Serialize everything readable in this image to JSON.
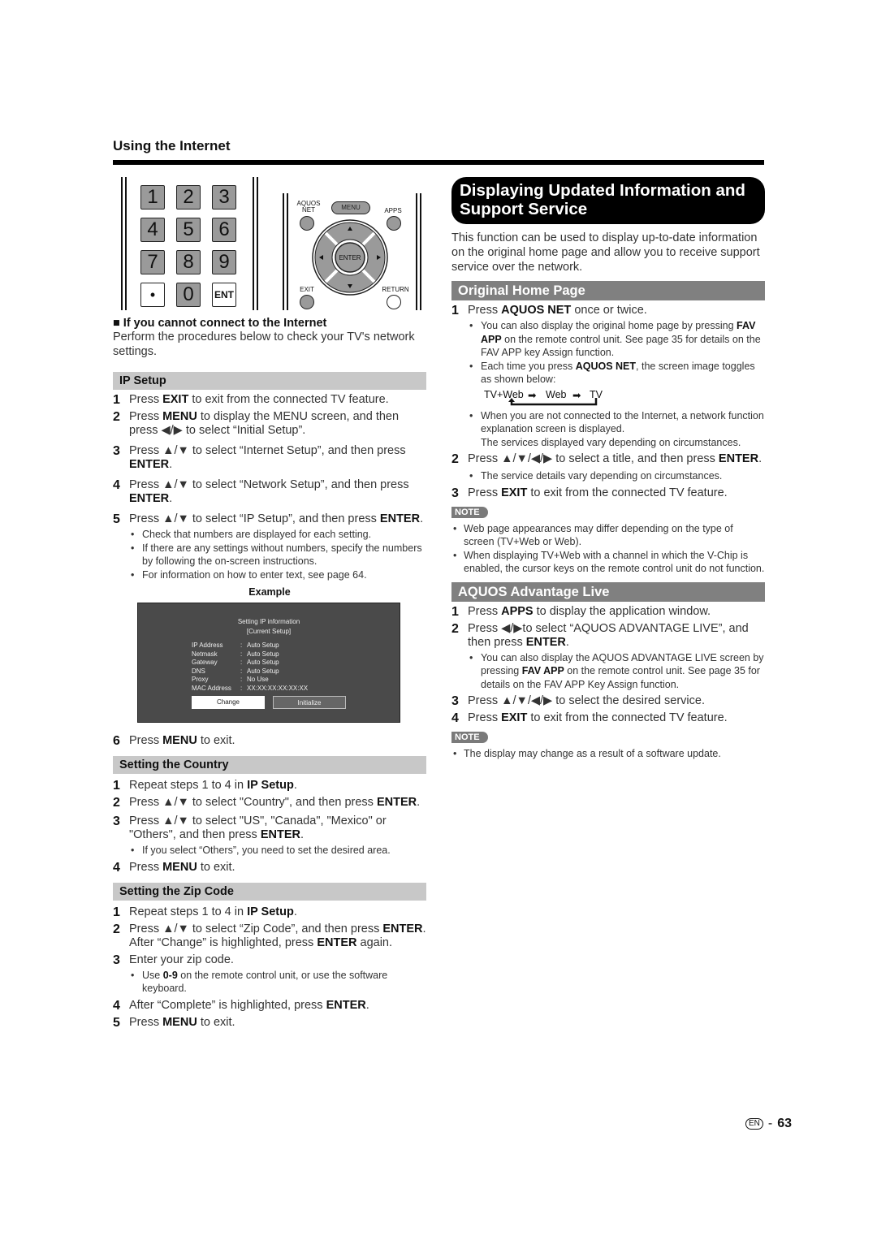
{
  "header": {
    "section_title": "Using the Internet"
  },
  "remote": {
    "keys": [
      "1",
      "2",
      "3",
      "4",
      "5",
      "6",
      "7",
      "8",
      "9",
      "•",
      "0",
      "ENT"
    ],
    "buttons": {
      "aquos_net": "AQUOS NET",
      "menu": "MENU",
      "apps": "APPS",
      "enter": "ENTER",
      "exit": "EXIT",
      "return": "RETURN"
    }
  },
  "left": {
    "cannot_connect_title": "If you cannot connect to the Internet",
    "cannot_connect_text": "Perform the procedures below to check your TV's network settings.",
    "ip_setup": {
      "bar": "IP Setup",
      "steps": [
        {
          "n": "1",
          "pre": "Press ",
          "b": "EXIT",
          "post": " to exit from the connected TV feature."
        },
        {
          "n": "2",
          "pre": "Press ",
          "b": "MENU",
          "post": " to display the MENU screen, and then press ◀/▶ to select “Initial Setup”."
        },
        {
          "n": "3",
          "pre": "Press ▲/▼ to select “Internet Setup”, and then press ",
          "b": "ENTER",
          "post": "."
        },
        {
          "n": "4",
          "pre": "Press ▲/▼ to select “Network Setup”, and then press ",
          "b": "ENTER",
          "post": "."
        },
        {
          "n": "5",
          "pre": "Press ▲/▼ to select “IP Setup”, and then press ",
          "b": "ENTER",
          "post": "."
        }
      ],
      "bullets": [
        "Check that numbers are displayed for each setting.",
        "If there are any settings without numbers, specify the numbers by following the on-screen instructions.",
        "For information on how to enter text, see page 64."
      ],
      "example_label": "Example",
      "screen": {
        "title": "Setting IP information",
        "subtitle": "[Current Setup]",
        "rows": [
          {
            "k": "IP Address",
            "v": "Auto Setup"
          },
          {
            "k": "Netmask",
            "v": "Auto Setup"
          },
          {
            "k": "Gateway",
            "v": "Auto Setup"
          },
          {
            "k": "DNS",
            "v": "Auto Setup"
          },
          {
            "k": "Proxy",
            "v": "No Use"
          },
          {
            "k": "MAC Address",
            "v": "XX:XX:XX:XX:XX:XX"
          }
        ],
        "change_button": "Change",
        "initialize_button": "Initialize"
      },
      "step6": {
        "n": "6",
        "pre": "Press ",
        "b": "MENU",
        "post": " to exit."
      }
    },
    "country": {
      "bar": "Setting the Country",
      "steps": [
        {
          "n": "1",
          "pre": "Repeat steps 1 to 4 in ",
          "b": "IP Setup",
          "post": "."
        },
        {
          "n": "2",
          "pre": "Press ▲/▼ to select \"Country\", and then press ",
          "b": "ENTER",
          "post": "."
        },
        {
          "n": "3",
          "pre": "Press ▲/▼ to select \"US\", \"Canada\", \"Mexico\" or \"Others\", and then press ",
          "b": "ENTER",
          "post": "."
        }
      ],
      "bullet": "If you select “Others”, you need to set the desired area.",
      "step4": {
        "n": "4",
        "pre": "Press ",
        "b": "MENU",
        "post": " to exit."
      }
    },
    "zip": {
      "bar": "Setting the Zip Code",
      "step1": {
        "n": "1",
        "pre": "Repeat steps 1 to 4 in ",
        "b": "IP Setup",
        "post": "."
      },
      "step2": {
        "n": "2",
        "pre": "Press ▲/▼ to select “Zip Code”, and then press ",
        "b": "ENTER",
        "mid": ". After “Change” is highlighted, press ",
        "b2": "ENTER",
        "post": " again."
      },
      "step3": {
        "n": "3",
        "text": "Enter your zip code."
      },
      "bullet": {
        "pre": "Use ",
        "b": "0-9",
        "post": " on the remote control unit, or use the software keyboard."
      },
      "step4": {
        "n": "4",
        "pre": "After “Complete” is highlighted, press ",
        "b": "ENTER",
        "post": "."
      },
      "step5": {
        "n": "5",
        "pre": "Press ",
        "b": "MENU",
        "post": " to exit."
      }
    }
  },
  "right": {
    "title": "Displaying Updated Information and Support Service",
    "intro": "This function can be used to display up-to-date information on the original home page and allow you to receive support service over the network.",
    "home": {
      "bar": "Original Home Page",
      "step1": {
        "n": "1",
        "pre": "Press ",
        "b": "AQUOS NET",
        "post": " once or twice."
      },
      "b1": {
        "pre": "You can also display the original home page by pressing ",
        "b": "FAV APP",
        "post": " on the remote control unit. See page 35 for details on the FAV APP key Assign function."
      },
      "b2": {
        "pre": "Each time you press ",
        "b": "AQUOS NET",
        "post": ", the screen image toggles as shown below:"
      },
      "toggle": [
        "TV+Web",
        "Web",
        "TV"
      ],
      "b3a": "When you are not connected to the Internet, a network function explanation screen is displayed.",
      "b3b": "The services displayed vary depending on circumstances.",
      "step2": {
        "n": "2",
        "pre": "Press ▲/▼/◀/▶ to select a title, and then press ",
        "b": "ENTER",
        "post": "."
      },
      "b4": "The service details vary depending on circumstances.",
      "step3": {
        "n": "3",
        "pre": "Press ",
        "b": "EXIT",
        "post": " to exit from the connected TV feature."
      },
      "note_label": "NOTE",
      "notes": [
        "Web page appearances may differ depending on the type of screen (TV+Web or Web).",
        "When displaying TV+Web with a channel in which the V-Chip is enabled, the cursor keys on the remote control unit do not function."
      ]
    },
    "advantage": {
      "bar": "AQUOS Advantage Live",
      "step1": {
        "n": "1",
        "pre": "Press ",
        "b": "APPS",
        "post": " to display the application window."
      },
      "step2": {
        "n": "2",
        "pre": "Press ◀/▶to select “AQUOS ADVANTAGE LIVE”, and then press ",
        "b": "ENTER",
        "post": "."
      },
      "b1": {
        "pre": "You can also display the AQUOS ADVANTAGE LIVE screen by pressing ",
        "b": "FAV APP",
        "post": " on the remote control unit. See page 35 for details on the FAV APP Key Assign function."
      },
      "step3": {
        "n": "3",
        "text": "Press ▲/▼/◀/▶ to select the desired service."
      },
      "step4": {
        "n": "4",
        "pre": "Press ",
        "b": "EXIT",
        "post": " to exit from the connected TV feature."
      },
      "note_label": "NOTE",
      "notes": [
        "The display may change as a result of a software update."
      ]
    }
  },
  "footer": {
    "lang": "EN",
    "separator": "-",
    "page": "63"
  }
}
